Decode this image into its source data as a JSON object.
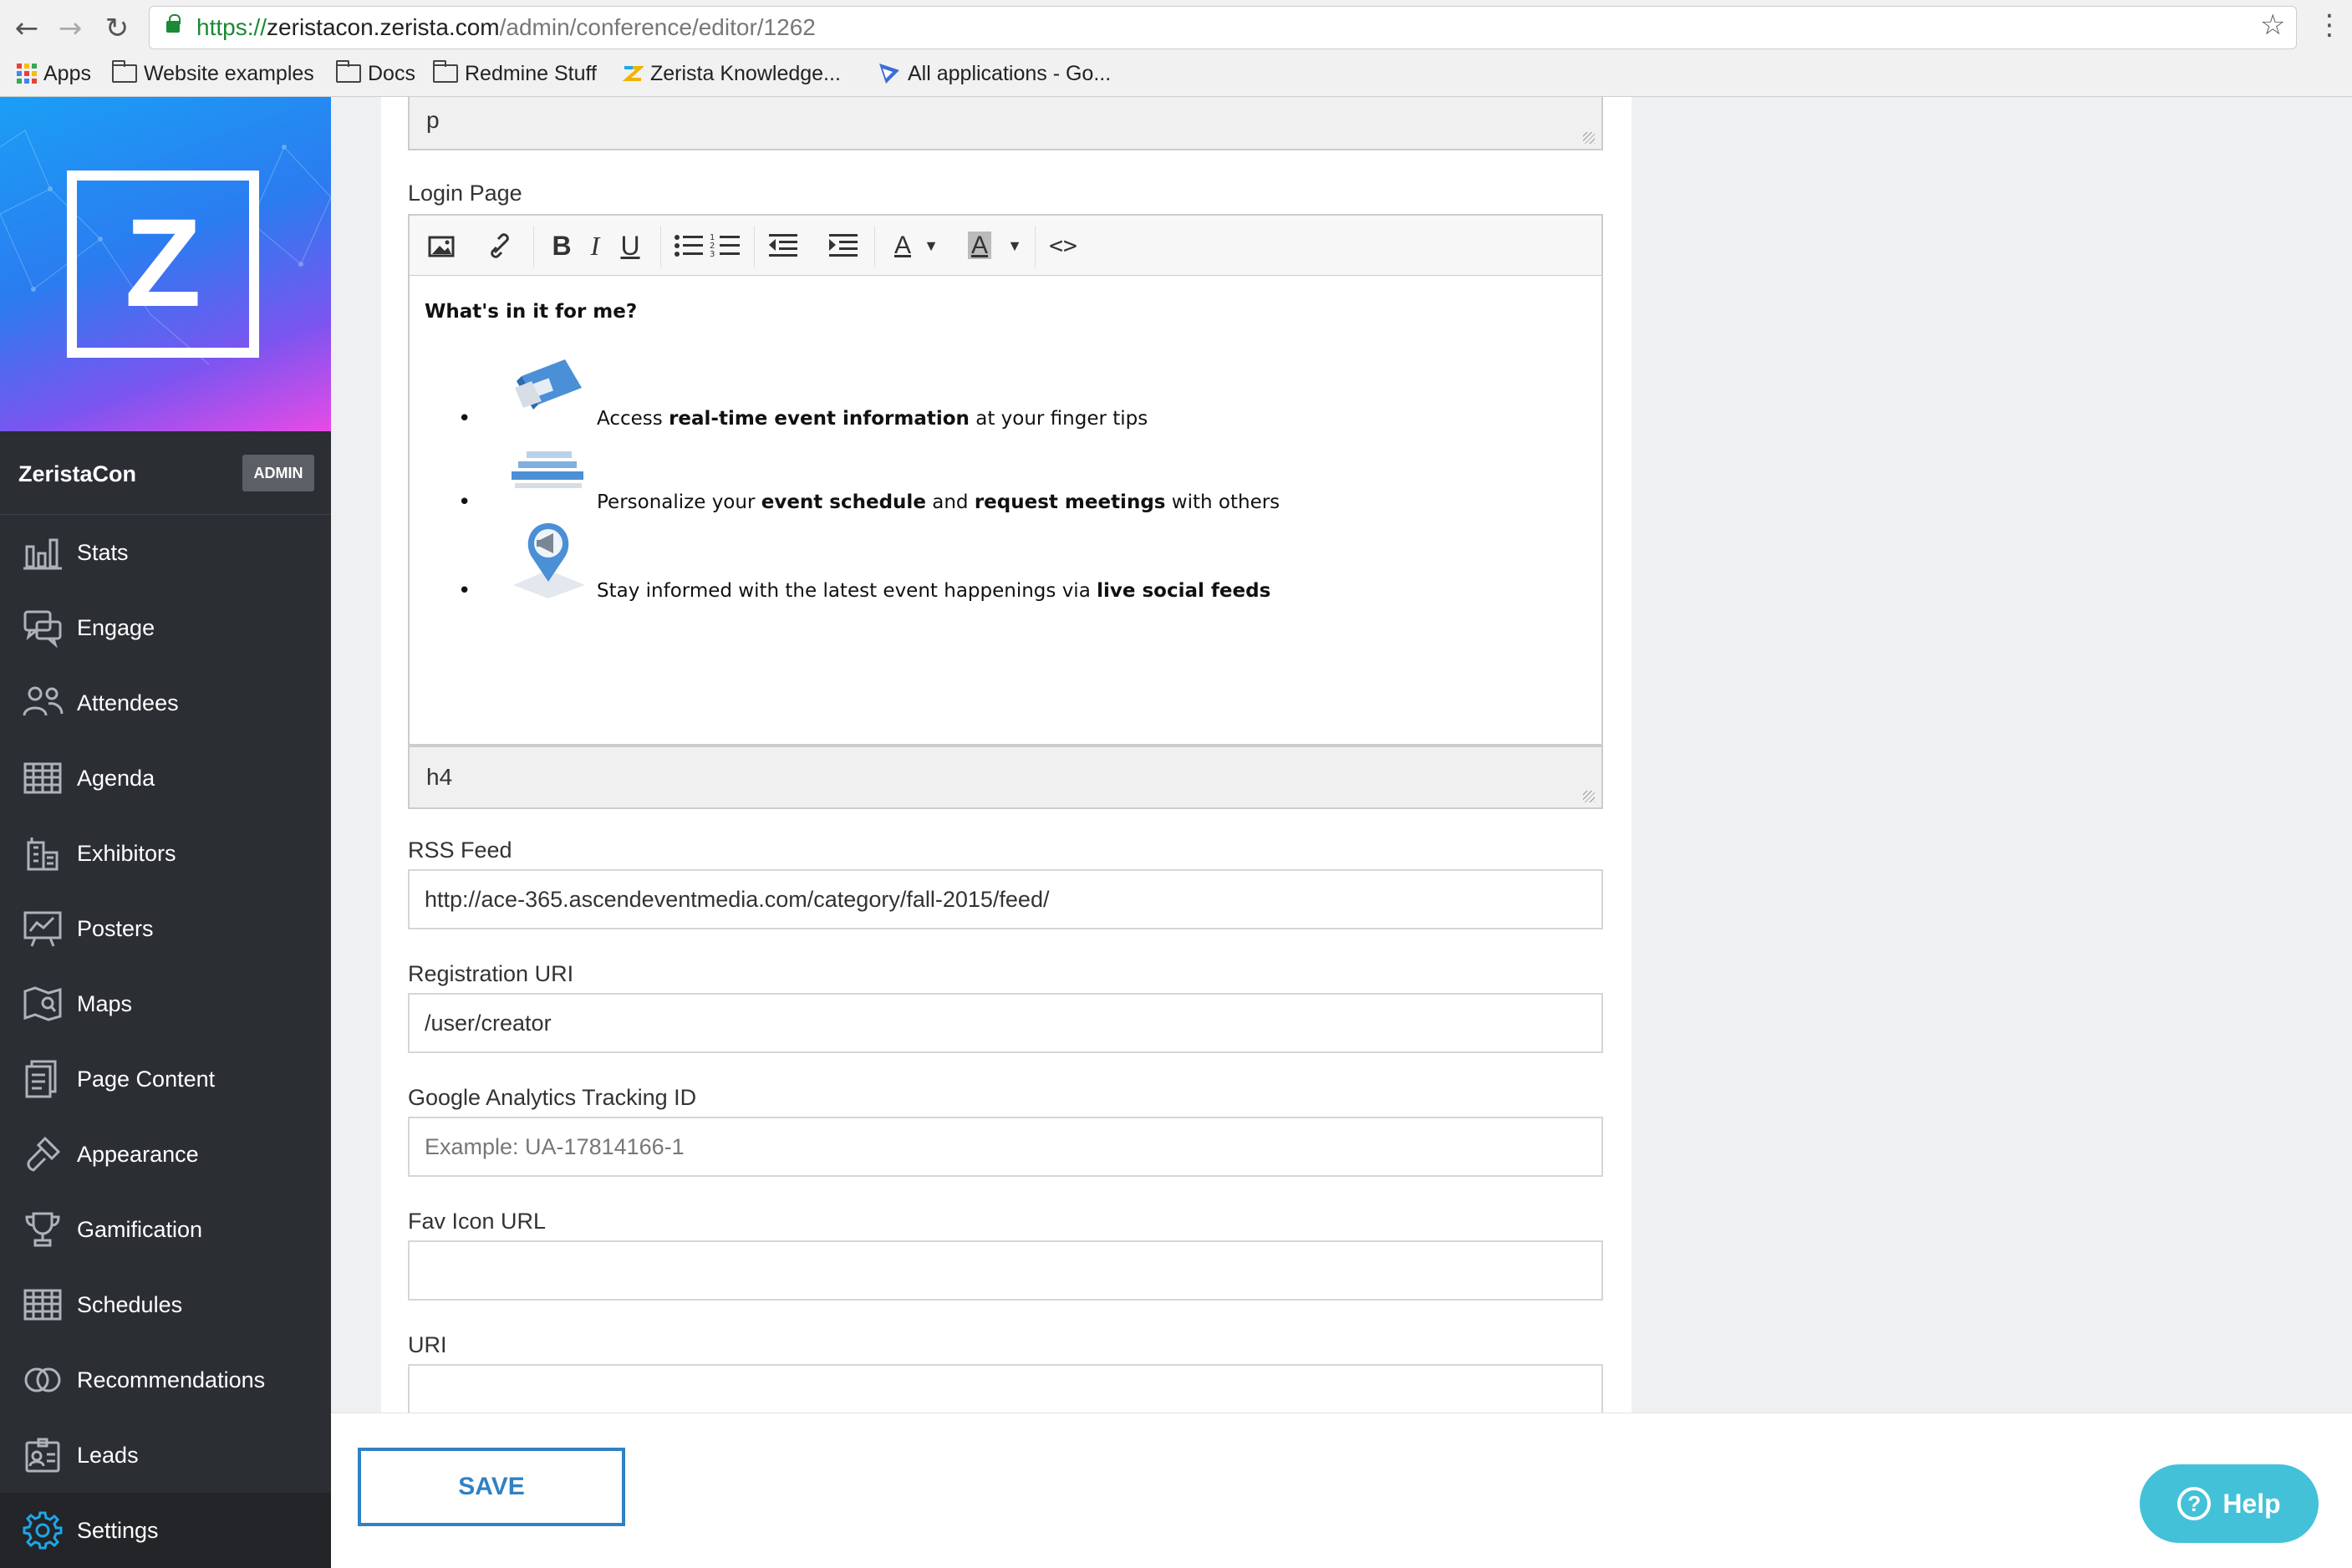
{
  "browser": {
    "url_scheme": "https://",
    "url_host": "zeristacon.zerista.com",
    "url_path": "/admin/conference/editor/1262",
    "bookmarks": [
      {
        "label": "Apps",
        "icon": "apps-grid-icon"
      },
      {
        "label": "Website examples",
        "icon": "folder-icon"
      },
      {
        "label": "Docs",
        "icon": "folder-icon"
      },
      {
        "label": "Redmine Stuff",
        "icon": "folder-icon"
      },
      {
        "label": "Zerista Knowledge...",
        "icon": "zerista-favicon"
      },
      {
        "label": "All applications - Go...",
        "icon": "google-apps-favicon"
      }
    ]
  },
  "sidebar": {
    "logo_letter": "Z",
    "conference_name": "ZeristaCon",
    "badge": "ADMIN",
    "items": [
      {
        "label": "Stats",
        "icon": "bar-chart-icon"
      },
      {
        "label": "Engage",
        "icon": "chat-bubbles-icon"
      },
      {
        "label": "Attendees",
        "icon": "people-icon"
      },
      {
        "label": "Agenda",
        "icon": "calendar-grid-icon"
      },
      {
        "label": "Exhibitors",
        "icon": "building-icon"
      },
      {
        "label": "Posters",
        "icon": "presentation-board-icon"
      },
      {
        "label": "Maps",
        "icon": "map-icon"
      },
      {
        "label": "Page Content",
        "icon": "document-icon"
      },
      {
        "label": "Appearance",
        "icon": "paintbrush-icon"
      },
      {
        "label": "Gamification",
        "icon": "trophy-icon"
      },
      {
        "label": "Schedules",
        "icon": "schedule-grid-icon"
      },
      {
        "label": "Recommendations",
        "icon": "overlapping-circles-icon"
      },
      {
        "label": "Leads",
        "icon": "id-badge-icon"
      },
      {
        "label": "Settings",
        "icon": "gear-icon"
      }
    ],
    "active_item": "Settings"
  },
  "form": {
    "prev_editor_path": "p",
    "login_page_label": "Login Page",
    "toolbar": [
      "image",
      "link",
      "bold",
      "italic",
      "underline",
      "bulleted-list",
      "numbered-list",
      "outdent",
      "indent",
      "text-color",
      "background-color",
      "source-code"
    ],
    "login_editor": {
      "heading": "What's in it for me?",
      "items": [
        {
          "pre": "Access ",
          "bold": "real-time event information",
          "post": " at your finger tips"
        },
        {
          "pre": "Personalize your ",
          "bold": "event schedule",
          "mid": " and ",
          "bold2": "request meetings",
          "post": " with others"
        },
        {
          "pre": "Stay informed with the latest event happenings via ",
          "bold": "live social feeds",
          "post": ""
        }
      ],
      "path": "h4"
    },
    "rss_label": "RSS Feed",
    "rss_value": "http://ace-365.ascendeventmedia.com/category/fall-2015/feed/",
    "registration_label": "Registration URI",
    "registration_value": "/user/creator",
    "ga_label": "Google Analytics Tracking ID",
    "ga_placeholder": "Example: UA-17814166-1",
    "favicon_label": "Fav Icon URL",
    "favicon_value": "",
    "uri_label": "URI",
    "uri_value": ""
  },
  "footer": {
    "save_label": "SAVE",
    "help_label": "Help",
    "help_icon_glyph": "?"
  },
  "colors": {
    "sidebar_bg": "#2b2e33",
    "accent_blue": "#2f82c4",
    "help_teal": "#43c1d9",
    "active_icon": "#1ea7e8"
  }
}
